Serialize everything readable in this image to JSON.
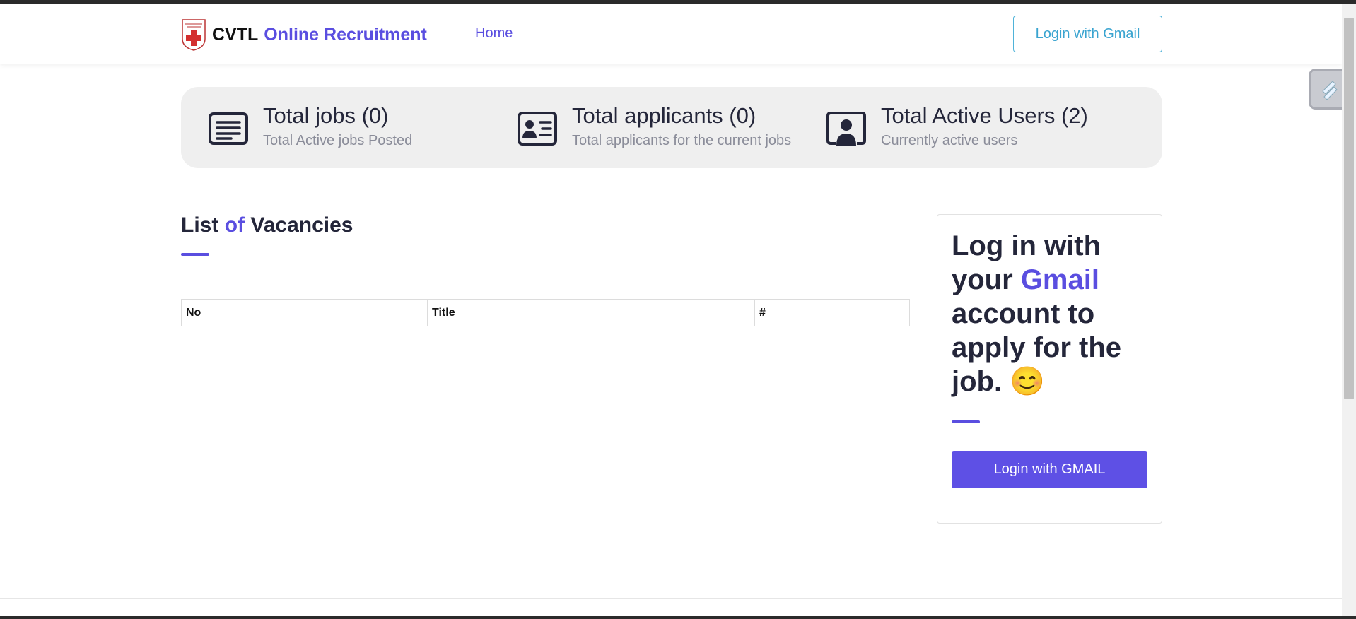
{
  "header": {
    "brand_name": "CVTL",
    "brand_accent": "Online Recruitment",
    "nav_home": "Home",
    "login_button": "Login with Gmail"
  },
  "stats": [
    {
      "title": "Total jobs (0)",
      "subtitle": "Total Active jobs Posted",
      "icon": "document-lines-icon"
    },
    {
      "title": "Total applicants (0)",
      "subtitle": "Total applicants for the current jobs",
      "icon": "id-card-icon"
    },
    {
      "title": "Total Active Users (2)",
      "subtitle": "Currently active users",
      "icon": "user-frame-icon"
    }
  ],
  "vacancies": {
    "title_part1": "List",
    "title_accent": "of",
    "title_part2": "Vacancies",
    "columns": [
      "No",
      "Title",
      "#"
    ]
  },
  "login_card": {
    "text_part1": "Log in with your",
    "text_accent": "Gmail",
    "text_part2": "account to apply for the job.",
    "emoji": "😊",
    "button": "Login with GMAIL"
  },
  "colors": {
    "accent": "#5a4ee0",
    "button_bg": "#5e50e5",
    "outline_button": "#3aa4d0",
    "stats_bg": "#efefef"
  }
}
